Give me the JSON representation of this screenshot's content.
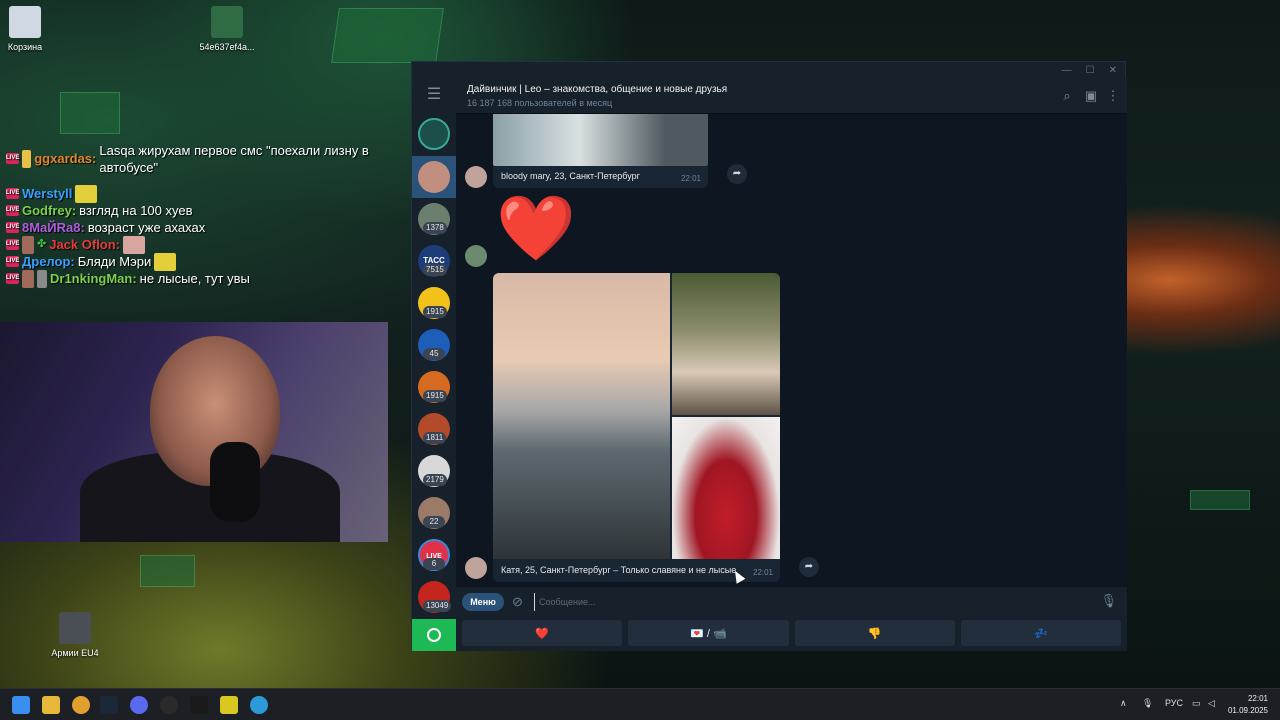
{
  "desktop": {
    "icons": [
      {
        "label": "Корзина"
      },
      {
        "label": "54e637ef4a..."
      },
      {
        "label": "Армии EU4"
      }
    ]
  },
  "stream_chat": [
    {
      "user": "ggxardas:",
      "text": "Lasqa жирухам первое смс \"поехали лизну в автобусе\""
    },
    {
      "user": "Werstyll",
      "text": ""
    },
    {
      "user": "Godfrey:",
      "text": "взгляд на 100 хуев"
    },
    {
      "user": "8MaЙRa8:",
      "text": "возраст уже ахахах"
    },
    {
      "user": "Jack Oflon:",
      "text": ""
    },
    {
      "user": "Дрелор:",
      "text": "Бляди Мэри"
    },
    {
      "user": "Dr1nkingMan:",
      "text": "не лысые, тут увы"
    }
  ],
  "telegram": {
    "channel_title": "Дайвинчик | Leo – знакомства, общение и новые друзья",
    "channel_subtitle": "16 187 168 пользователей в месяц",
    "rail": {
      "badges": [
        "1378",
        "7515",
        "1915",
        "45",
        "1915",
        "1811",
        "2179",
        "22",
        "6",
        "13049"
      ],
      "labels": {
        "tass": "ТАСС",
        "live": "LIVE"
      }
    },
    "messages": [
      {
        "caption": "bloody mary, 23, Санкт-Петербург",
        "time": "22:01"
      },
      {
        "emoji": "❤️"
      },
      {
        "caption": "Катя, 25, Санкт-Петербург – Только славяне и не лысые",
        "time": "22:01"
      }
    ],
    "input": {
      "menu_label": "Меню",
      "placeholder": "Сообщение..."
    },
    "keyboard": [
      "❤️",
      "💌 / 📹",
      "👎",
      "💤"
    ]
  },
  "taskbar": {
    "lang": "РУС",
    "time": "22:01",
    "date": "01.09.2025"
  },
  "colors": {
    "tg_bg": "#0e1621",
    "tg_panel": "#17212b",
    "tg_accent": "#2b5278",
    "heart": "#e0141e"
  }
}
